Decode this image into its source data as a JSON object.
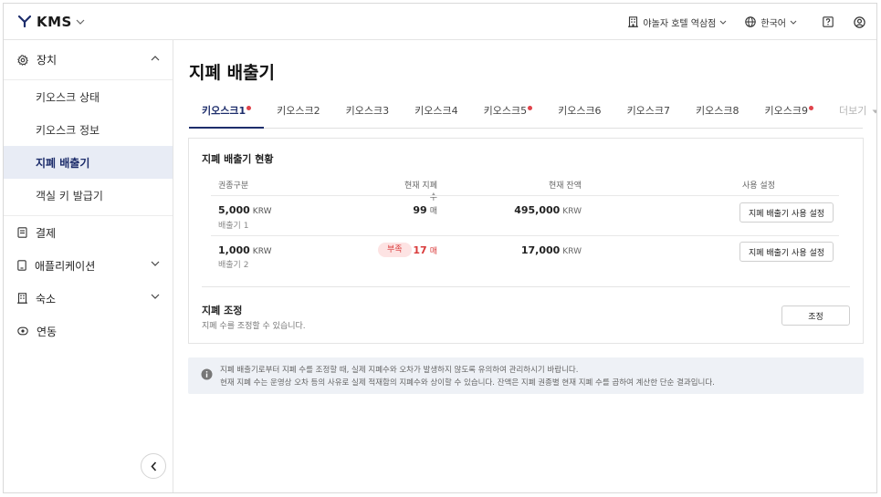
{
  "header": {
    "brand": "KMS",
    "hotel": "야놀자 호텔 역삼점",
    "language": "한국어"
  },
  "sidebar": {
    "device": {
      "label": "장치",
      "items": [
        {
          "label": "키오스크 상태"
        },
        {
          "label": "키오스크 정보"
        },
        {
          "label": "지폐 배출기"
        },
        {
          "label": "객실 키 발급기"
        }
      ],
      "active_index": 2
    },
    "groups": [
      {
        "label": "결제"
      },
      {
        "label": "애플리케이션"
      },
      {
        "label": "숙소"
      },
      {
        "label": "연동"
      }
    ]
  },
  "main": {
    "title": "지폐 배출기",
    "tabs": [
      {
        "label": "키오스크1",
        "dot": true
      },
      {
        "label": "키오스크2",
        "dot": false
      },
      {
        "label": "키오스크3",
        "dot": false
      },
      {
        "label": "키오스크4",
        "dot": false
      },
      {
        "label": "키오스크5",
        "dot": true
      },
      {
        "label": "키오스크6",
        "dot": false
      },
      {
        "label": "키오스크7",
        "dot": false
      },
      {
        "label": "키오스크8",
        "dot": false
      },
      {
        "label": "키오스크9",
        "dot": true
      },
      {
        "label": "더보기",
        "dot": false
      }
    ],
    "status": {
      "title": "지폐 배출기 현황",
      "columns": {
        "denomination": "권종구분",
        "count": "현재 지폐 수",
        "balance": "현재 잔액",
        "setting": "사용 설정"
      },
      "rows": [
        {
          "amount": "5,000",
          "currency": "KRW",
          "dispenser": "배출기 1",
          "count": "99",
          "count_unit": "매",
          "balance": "495,000",
          "balance_unit": "KRW",
          "button": "지폐 배출기 사용 설정"
        },
        {
          "amount": "1,000",
          "currency": "KRW",
          "dispenser": "배출기 2",
          "badge": "부족",
          "count": "17",
          "count_unit": "매",
          "balance": "17,000",
          "balance_unit": "KRW",
          "button": "지폐 배출기 사용 설정"
        }
      ]
    },
    "adjust": {
      "title": "지폐 조정",
      "desc": "지폐 수를 조정할 수 있습니다.",
      "button": "조정"
    },
    "notice": {
      "line1": "지폐 배출기로부터 지폐 수를 조정할 때, 실제 지폐수와 오차가 발생하지 않도록 유의하여 관리하시기 바랍니다.",
      "line2": "현재 지폐 수는 운영상 오차 등의 사유로 실제 적재함의 지폐수와 상이할 수 있습니다. 잔액은 지폐 권종별 현재 지폐 수를 곱하여 계산한 단순 결과입니다."
    }
  },
  "colors": {
    "accent": "#1d2d6b",
    "active_bg": "#e8ecf5",
    "warning": "#d93b3b",
    "warning_bg": "#fde3e3",
    "notice_bg": "#eef1f6"
  }
}
